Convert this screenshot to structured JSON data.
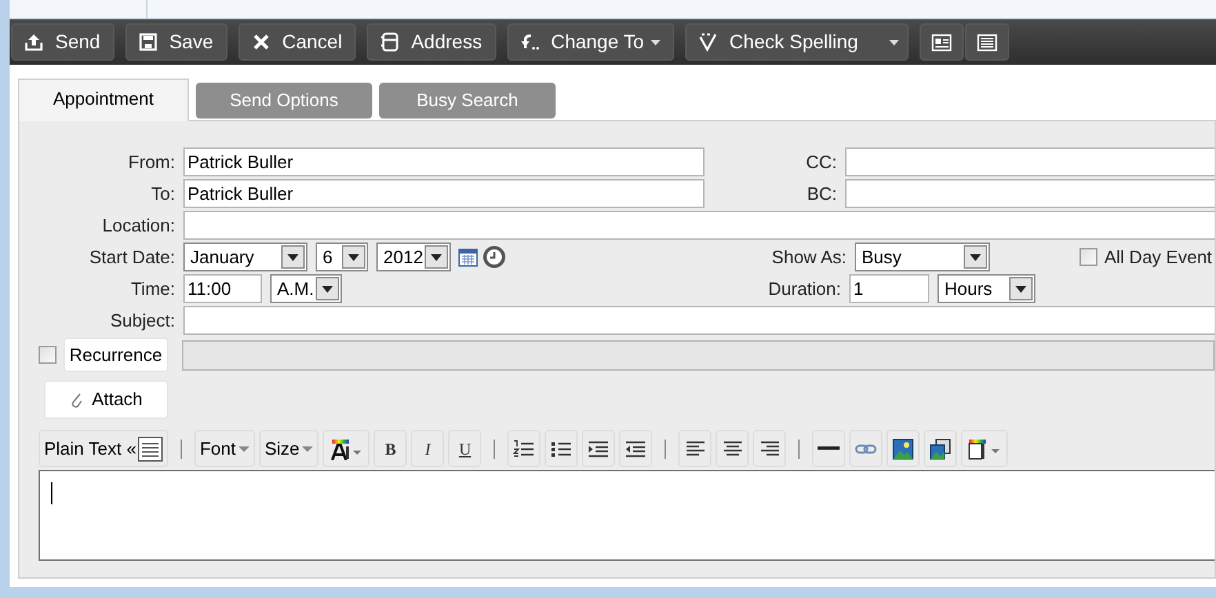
{
  "toolbar": [
    {
      "kind": "button",
      "label": "Send",
      "menu": false
    },
    {
      "kind": "button",
      "label": "Save",
      "menu": false
    },
    {
      "kind": "button",
      "label": "Cancel",
      "menu": false
    },
    {
      "kind": "button",
      "label": "Address",
      "menu": false
    },
    {
      "kind": "button",
      "label": "Change To",
      "menu": true
    },
    {
      "kind": "split",
      "label": "Check Spelling",
      "menu": true
    },
    {
      "kind": "icon"
    },
    {
      "kind": "icon"
    }
  ],
  "tabs": [
    {
      "label": "Appointment",
      "selected": true
    },
    {
      "label": "Send Options",
      "selected": false
    },
    {
      "label": "Busy Search",
      "selected": false
    }
  ],
  "form": {
    "from": {
      "label": "From:",
      "value": "Patrick Buller"
    },
    "cc": {
      "label": "CC:"
    },
    "to": {
      "label": "To:",
      "value": "Patrick Buller"
    },
    "bc": {
      "label": "BC:"
    },
    "location": {
      "label": "Location:"
    },
    "start_date": {
      "label": "Start Date:",
      "month": "January",
      "day": "6",
      "year": "2012"
    },
    "show_as": {
      "label": "Show As:",
      "value": "Busy"
    },
    "all_day": {
      "label": "All Day Event",
      "checked": false
    },
    "time": {
      "label": "Time:",
      "value": "11:00",
      "period": "A.M."
    },
    "duration": {
      "label": "Duration:",
      "value": "1",
      "unit": "Hours"
    },
    "subject": {
      "label": "Subject:"
    },
    "recurrence": {
      "label": "Recurrence",
      "checked": false
    },
    "attach": {
      "label": "Attach"
    }
  },
  "format_toolbar": [
    {
      "kind": "mode",
      "label": "Plain Text «"
    },
    {
      "kind": "separator"
    },
    {
      "kind": "menu",
      "label": "Font"
    },
    {
      "kind": "menu",
      "label": "Size"
    },
    {
      "kind": "icon"
    },
    {
      "kind": "glyph",
      "label": "B"
    },
    {
      "kind": "glyph",
      "label": "I"
    },
    {
      "kind": "glyph",
      "label": "U"
    },
    {
      "kind": "separator"
    },
    {
      "kind": "icon"
    },
    {
      "kind": "icon"
    },
    {
      "kind": "icon"
    },
    {
      "kind": "icon"
    },
    {
      "kind": "separator"
    },
    {
      "kind": "icon"
    },
    {
      "kind": "icon"
    },
    {
      "kind": "icon"
    },
    {
      "kind": "separator"
    },
    {
      "kind": "icon"
    },
    {
      "kind": "icon"
    },
    {
      "kind": "icon"
    },
    {
      "kind": "icon"
    },
    {
      "kind": "icon"
    }
  ]
}
